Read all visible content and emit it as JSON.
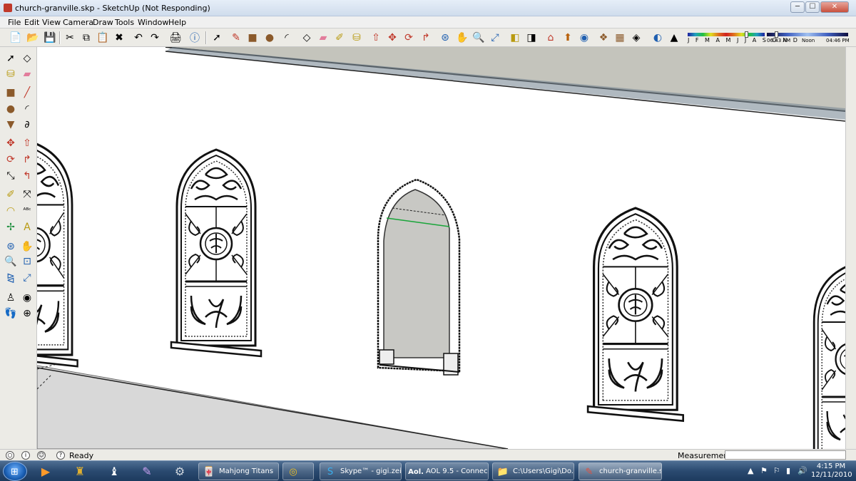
{
  "window": {
    "title": "church-granville.skp - SketchUp (Not Responding)",
    "btn_min": "─",
    "btn_max": "☐",
    "btn_close": "✕"
  },
  "menu": [
    "File",
    "Edit",
    "View",
    "Camera",
    "Draw",
    "Tools",
    "Window",
    "Help"
  ],
  "toolbar_icons": [
    "new-icon",
    "open-icon",
    "save-icon",
    "cut-icon",
    "copy-icon",
    "paste-icon",
    "erase-icon",
    "undo-icon",
    "redo-icon",
    "print-icon",
    "model-info-icon",
    "select-icon",
    "pencil-icon",
    "rectangle-icon",
    "circle-icon",
    "arc-icon",
    "make-component-icon",
    "eraser-icon",
    "tape-icon",
    "paint-bucket-icon",
    "push-pull-icon",
    "move-icon",
    "rotate-icon",
    "follow-me-icon",
    "orbit-icon",
    "pan-icon",
    "zoom-icon",
    "zoom-extents-icon",
    "previous-icon",
    "next-icon",
    "warehouse-icon",
    "share-model-icon",
    "google-earth-icon",
    "components-icon",
    "materials-icon",
    "styles-icon",
    "shadows-icon",
    "fog-icon"
  ],
  "shadow": {
    "months": "J F M A M J J A S O N D",
    "time_start": "06:43 AM",
    "time_mid": "Noon",
    "time_end": "04:46 PM",
    "month_position": 0.78,
    "time_position": 0.1
  },
  "status": {
    "message": "Ready",
    "measurements_label": "Measurements",
    "measurements_value": ""
  },
  "taskbar": {
    "tasks": [
      {
        "label": "Mahjong Titans",
        "icon": "mahjong-icon"
      },
      {
        "label": "",
        "icon": "aol-disc-icon"
      },
      {
        "label": "Skype™ - gigi.zeitl...",
        "icon": "skype-icon"
      },
      {
        "label": "AOL 9.5 - Connec...",
        "icon": "aol-icon"
      },
      {
        "label": "C:\\Users\\Gigi\\Do...",
        "icon": "folder-icon"
      },
      {
        "label": "church-granville.s...",
        "icon": "sketchup-icon"
      }
    ],
    "clock_time": "4:15 PM",
    "clock_date": "12/11/2010"
  }
}
